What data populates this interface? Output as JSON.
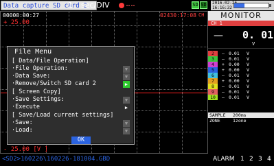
{
  "header": {
    "title": "Data capture SD card 2",
    "page_number": "1",
    "time_per_div": "sec/DIV",
    "sd_icons": [
      "SD",
      "SD"
    ],
    "date": "2016-02-26",
    "time": "16:16:32",
    "battery_level": 0.3
  },
  "graph": {
    "start_time": "00000:00:27",
    "end_time": "02430:17:08",
    "cut_label": "CH",
    "upper_scale": "+ 25.00",
    "lower_scale": "- 25.00 [V  ]"
  },
  "file_menu": {
    "title": "File Menu",
    "items": [
      {
        "label": "[ Data/File Operation]",
        "section": true
      },
      {
        "label": "·File Operation:",
        "button": "▼",
        "style": "gray"
      },
      {
        "label": "·Data Save:",
        "button": "▼",
        "style": "gray"
      },
      {
        "label": "·Remove/Switch SD card 2",
        "button": "▶",
        "style": "green"
      },
      {
        "label": "[ Screen Copy]",
        "section": true
      },
      {
        "label": "·Save Settings:",
        "button": "▼",
        "style": "gray"
      },
      {
        "label": "·Execute",
        "button": "▶",
        "style": "white"
      },
      {
        "label": "[ Save/Load current settings]",
        "section": true
      },
      {
        "label": "·Save:",
        "button": "▼",
        "style": "gray"
      },
      {
        "label": "·Load:",
        "button": "▼",
        "style": "gray"
      }
    ],
    "ok_label": "OK"
  },
  "monitor": {
    "title": "MONITOR",
    "ch1_label": "CH 1",
    "ch1_sign": "—",
    "ch1_value": "0. 01",
    "ch1_unit": "V",
    "channels": [
      {
        "num": "2",
        "sign": "–",
        "value": "0.01",
        "unit": "V",
        "color": "#e04040"
      },
      {
        "num": "3",
        "sign": "–",
        "value": "0.01",
        "unit": "V",
        "color": "#3ec43e"
      },
      {
        "num": "4",
        "sign": "+",
        "value": "0.00",
        "unit": "V",
        "color": "#d040d0"
      },
      {
        "num": "5",
        "sign": "+",
        "value": "0.00",
        "unit": "V",
        "color": "#2b63e0"
      },
      {
        "num": "6",
        "sign": "–",
        "value": "0.01",
        "unit": "V",
        "color": "#40c0e0"
      },
      {
        "num": "7",
        "sign": "+",
        "value": "0.00",
        "unit": "V",
        "color": "#e0a020"
      },
      {
        "num": "8",
        "sign": "–",
        "value": "0.01",
        "unit": "V",
        "color": "#e0e020"
      },
      {
        "num": "9",
        "sign": "–",
        "value": "0.01",
        "unit": "V",
        "color": "#e06060"
      },
      {
        "num": "10",
        "sign": "–",
        "value": "0.01",
        "unit": "V",
        "color": "#a0e020"
      }
    ],
    "sample_label": "SAMPLE",
    "sample_value": "200ms",
    "zone_label": "ZONE",
    "zone_value": "1zone"
  },
  "footer": {
    "path": "<SD2>160226\\160226-181004.GBD",
    "alarm_label": "ALARM",
    "alarm_numbers": [
      "1",
      "2",
      "3",
      "4"
    ]
  }
}
